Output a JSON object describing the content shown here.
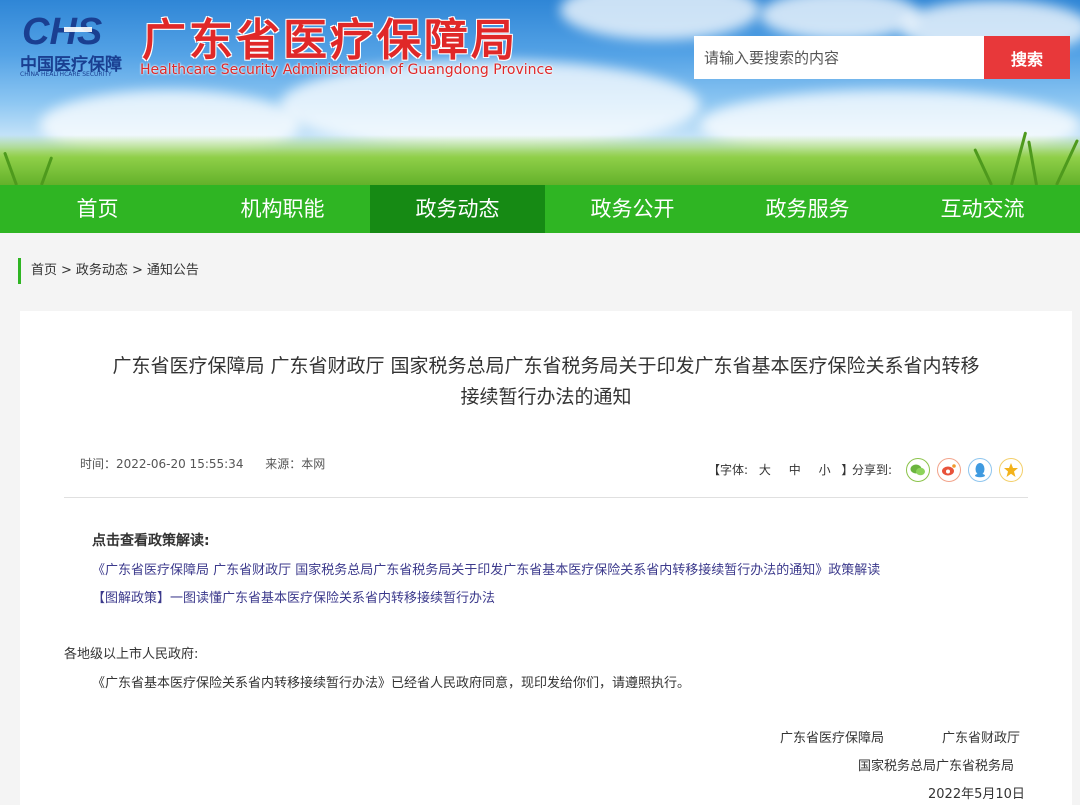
{
  "header": {
    "logo_letters": "CHS",
    "logo_cn": "中国医疗保障",
    "logo_en": "CHINA HEALTHCARE SECURITY",
    "title": "广东省医疗保障局",
    "subtitle": "Healthcare Security Administration of Guangdong Province",
    "search_placeholder": "请输入要搜索的内容",
    "search_button": "搜索"
  },
  "nav": {
    "items": [
      {
        "label": "首页",
        "active": false
      },
      {
        "label": "机构职能",
        "active": false
      },
      {
        "label": "政务动态",
        "active": true
      },
      {
        "label": "政务公开",
        "active": false
      },
      {
        "label": "政务服务",
        "active": false
      },
      {
        "label": "互动交流",
        "active": false
      }
    ]
  },
  "breadcrumb": [
    "首页",
    "政务动态",
    "通知公告"
  ],
  "article": {
    "title_line1": "广东省医疗保障局 广东省财政厅 国家税务总局广东省税务局关于印发广东省基本医疗保险关系省内转移",
    "title_line2": "接续暂行办法的通知",
    "time": "时间：2022-06-20 15:55:34",
    "source": "来源：本网",
    "font_label_open": "【字体:",
    "font_large": "大",
    "font_medium": "中",
    "font_small": "小",
    "font_label_close": "】",
    "share_label": "分享到:",
    "share_icons": [
      "wechat-icon",
      "weibo-icon",
      "qq-icon",
      "qzone-icon"
    ],
    "interp_heading": "点击查看政策解读:",
    "interp_links": [
      "《广东省医疗保障局 广东省财政厅 国家税务总局广东省税务局关于印发广东省基本医疗保险关系省内转移接续暂行办法的通知》政策解读",
      "【图解政策】一图读懂广东省基本医疗保险关系省内转移接续暂行办法"
    ],
    "salutation": "各地级以上市人民政府:",
    "body": "《广东省基本医疗保险关系省内转移接续暂行办法》已经省人民政府同意，现印发给你们，请遵照执行。",
    "signers": [
      "广东省医疗保障局",
      "广东省财政厅",
      "国家税务总局广东省税务局"
    ],
    "date": "2022年5月10日"
  }
}
